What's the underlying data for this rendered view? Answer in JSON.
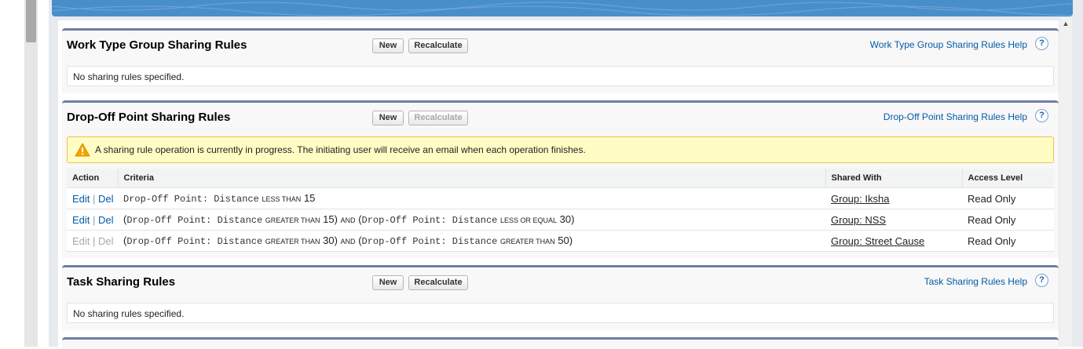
{
  "sections": {
    "work_type": {
      "title": "Work Type Group Sharing Rules",
      "new_label": "New",
      "recalc_label": "Recalculate",
      "help_label": "Work Type Group Sharing Rules Help",
      "help_icon": "?",
      "empty_text": "No sharing rules specified."
    },
    "dropoff": {
      "title": "Drop-Off Point Sharing Rules",
      "new_label": "New",
      "recalc_label": "Recalculate",
      "recalc_disabled": true,
      "help_label": "Drop-Off Point Sharing Rules Help",
      "help_icon": "?",
      "warning": "A sharing rule operation is currently in progress. The initiating user will receive an email when each operation finishes.",
      "columns": [
        "Action",
        "Criteria",
        "Shared With",
        "Access Level"
      ],
      "rows": [
        {
          "edit": "Edit",
          "sep": "|",
          "del": "Del",
          "disabled": false,
          "c1_field": "Drop-Off Point: Distance",
          "c1_op": "LESS THAN",
          "c1_val": "15",
          "shared_with": "Group: Iksha",
          "access": "Read Only"
        },
        {
          "edit": "Edit",
          "sep": "|",
          "del": "Del",
          "disabled": false,
          "c1_field": "Drop-Off Point: Distance",
          "c1_op": "GREATER THAN",
          "c1_val": "15",
          "conj": "AND",
          "c2_field": "Drop-Off Point: Distance",
          "c2_op": "LESS OR EQUAL",
          "c2_val": "30",
          "shared_with": "Group: NSS",
          "access": "Read Only"
        },
        {
          "edit": "Edit",
          "sep": "|",
          "del": "Del",
          "disabled": true,
          "c1_field": "Drop-Off Point: Distance",
          "c1_op": "GREATER THAN",
          "c1_val": "30",
          "conj": "AND",
          "c2_field": "Drop-Off Point: Distance",
          "c2_op": "GREATER THAN",
          "c2_val": "50",
          "shared_with": "Group: Street Cause",
          "access": "Read Only"
        }
      ]
    },
    "task": {
      "title": "Task Sharing Rules",
      "new_label": "New",
      "recalc_label": "Recalculate",
      "help_label": "Task Sharing Rules Help",
      "help_icon": "?",
      "empty_text": "No sharing rules specified."
    }
  },
  "colors": {
    "header_blue": "#4a8ec9",
    "section_border": "#6e7ea3",
    "link_blue": "#015ba7",
    "warning_bg": "#fffdc4",
    "warning_border": "#f0c04e"
  },
  "icons": {
    "warning": "warning-triangle-icon",
    "help": "help-question-icon",
    "scroll_up": "chevron-up-icon"
  }
}
